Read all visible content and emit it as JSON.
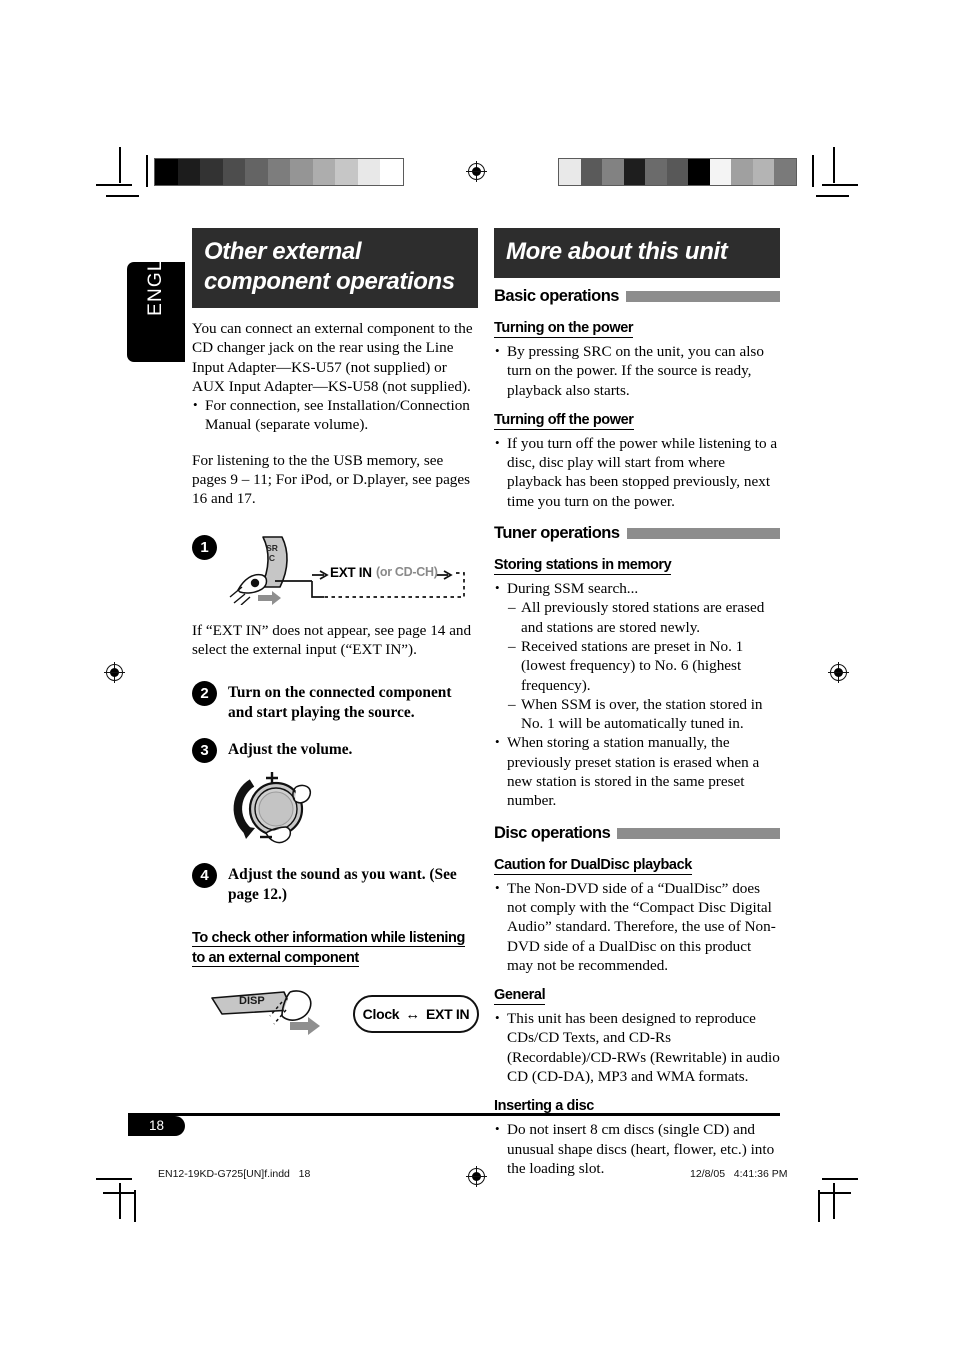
{
  "document": {
    "language_tab": "ENGLISH",
    "page_number": "18",
    "footer_file": "EN12-19KD-G725[UN]f.indd   18",
    "footer_timestamp": "12/8/05   4:41:36 PM"
  },
  "colors": {
    "title_bar": "#2d2d2d",
    "section_bar": "#8d8d8d",
    "text": "#000000",
    "muted_label": "#8a8a8a"
  },
  "left_column": {
    "title": "Other external component operations",
    "intro_paragraph": "You can connect an external component to the CD changer jack on the rear using the Line Input Adapter—KS-U57 (not supplied) or AUX Input Adapter—KS-U58 (not supplied).",
    "intro_bullets": [
      "For connection, see Installation/Connection Manual (separate volume)."
    ],
    "usb_note": "For listening to the the USB memory, see pages 9 – 11; For iPod, or D.player, see pages 16 and 17.",
    "steps": [
      {
        "number": "1",
        "figure": {
          "button_label": "SRC",
          "display_primary": "EXT IN",
          "display_secondary": "(or CD-CH)"
        },
        "note": "If “EXT IN” does not appear, see page 14 and select the external input (“EXT IN”)."
      },
      {
        "number": "2",
        "text": "Turn on the connected component and start playing the source."
      },
      {
        "number": "3",
        "text": "Adjust the volume.",
        "figure": {
          "plus": "+",
          "minus": "–"
        }
      },
      {
        "number": "4",
        "text": "Adjust the sound as you want. (See page 12.)"
      }
    ],
    "check_info": {
      "heading": "To check other information while listening to an external component",
      "button_label": "DISP",
      "display_left": "Clock",
      "display_arrow": "↔",
      "display_right": "EXT IN"
    }
  },
  "right_column": {
    "title": "More about this unit",
    "sections": [
      {
        "heading": "Basic operations",
        "subsections": [
          {
            "heading": "Turning on the power",
            "bullets": [
              "By pressing SRC on the unit, you can also turn on the power. If the source is ready, playback also starts."
            ]
          },
          {
            "heading": "Turning off the power",
            "bullets": [
              "If you turn off the power while listening to a disc, disc play will start from where playback has been stopped previously, next time you turn on the power."
            ]
          }
        ]
      },
      {
        "heading": "Tuner operations",
        "subsections": [
          {
            "heading": "Storing stations in memory",
            "bullets": [
              "During SSM search..."
            ],
            "dash_items": [
              "All previously stored stations are erased and stations are stored newly.",
              "Received stations are preset in No. 1 (lowest frequency) to No. 6 (highest frequency).",
              "When SSM is over, the station stored in No. 1 will be automatically tuned in."
            ],
            "bullets_after": [
              "When storing a station manually, the previously preset station is erased when a new station is stored in the same preset number."
            ]
          }
        ]
      },
      {
        "heading": "Disc operations",
        "subsections": [
          {
            "heading": "Caution for DualDisc playback",
            "bullets": [
              "The Non-DVD side of a “DualDisc” does not comply with the “Compact Disc Digital Audio” standard. Therefore, the use of Non-DVD side of a DualDisc on this product may not be recommended."
            ]
          },
          {
            "heading": "General",
            "bullets": [
              "This unit has been designed to reproduce CDs/CD Texts, and CD-Rs (Recordable)/CD-RWs (Rewritable) in audio CD (CD-DA), MP3 and WMA formats."
            ]
          },
          {
            "heading": "Inserting a disc",
            "bullets": [
              "Do not insert 8 cm discs (single CD) and unusual shape discs (heart, flower, etc.) into the loading slot."
            ]
          }
        ]
      }
    ]
  },
  "print_marks": {
    "gray_strip_left": [
      "#000000",
      "#1c1c1c",
      "#333333",
      "#4d4d4d",
      "#646464",
      "#7d7d7d",
      "#959595",
      "#adadad",
      "#c6c6c6",
      "#e8e8e8",
      "#ffffff"
    ],
    "gray_strip_right": [
      "#e9e9e9",
      "#5a5a5a",
      "#828282",
      "#1e1e1e",
      "#6b6b6b",
      "#585858",
      "#000000",
      "#f4f4f4",
      "#a0a0a0",
      "#b4b4b4",
      "#7a7a7a"
    ]
  }
}
